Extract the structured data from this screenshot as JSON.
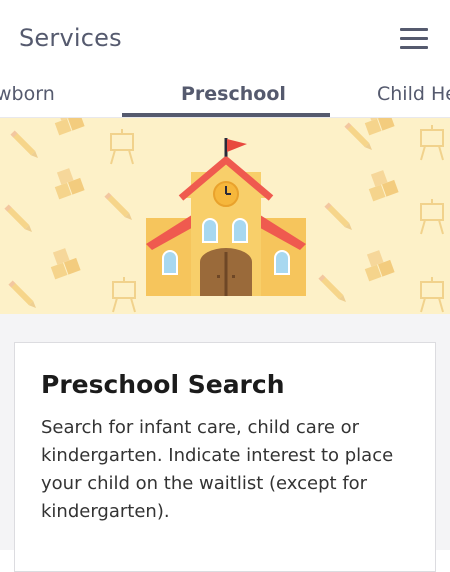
{
  "header": {
    "title": "Services",
    "menu_icon": "hamburger-menu-icon"
  },
  "tabs": [
    {
      "label": "Newborn",
      "visible_text": "wborn",
      "active": false
    },
    {
      "label": "Preschool",
      "visible_text": "Preschool",
      "active": true
    },
    {
      "label": "Child Health",
      "visible_text": "Child He",
      "active": false
    }
  ],
  "banner": {
    "illustration": "schoolhouse-icon",
    "background_color": "#fdf1c8",
    "pattern_icons": [
      "pencil-icon",
      "blocks-icon",
      "easel-icon"
    ]
  },
  "card": {
    "title": "Preschool Search",
    "description": "Search for infant care, child care or kindergarten. Indicate interest to place your child on the waitlist (except for kindergarten)."
  },
  "colors": {
    "text_primary": "#555a6e",
    "banner_bg": "#fdf1c8",
    "school_body": "#f6c55c",
    "roof": "#ef5a4f",
    "door": "#9a6a3a",
    "window": "#a8d8f0",
    "flag": "#e84a3f"
  }
}
